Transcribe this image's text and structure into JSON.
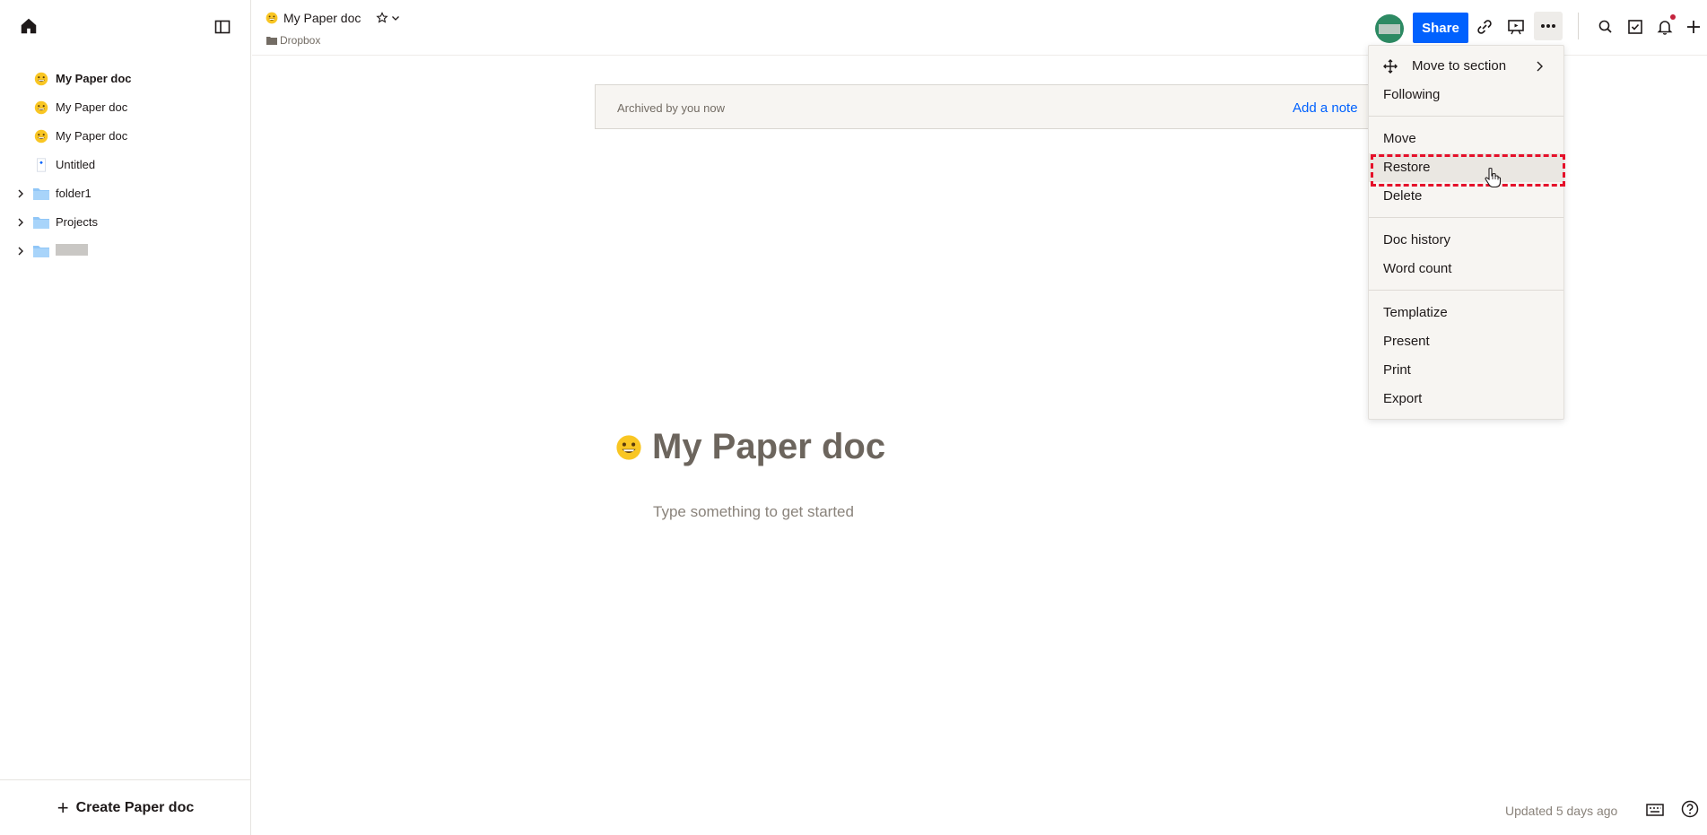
{
  "sidebar": {
    "items": [
      {
        "label": "My Paper doc",
        "icon": "emoji-grin-icon",
        "active": true
      },
      {
        "label": "My Paper doc",
        "icon": "emoji-grin-icon"
      },
      {
        "label": "My Paper doc",
        "icon": "emoji-grin-icon"
      },
      {
        "label": "Untitled",
        "icon": "doc-icon"
      },
      {
        "label": "folder1",
        "icon": "folder-icon",
        "expandable": true
      },
      {
        "label": "Projects",
        "icon": "folder-icon",
        "expandable": true
      },
      {
        "label": "",
        "icon": "folder-icon",
        "expandable": true,
        "redacted": true
      }
    ],
    "create_label": "Create Paper doc"
  },
  "header": {
    "doc_title": "My Paper doc",
    "breadcrumb": "Dropbox",
    "share_label": "Share"
  },
  "banner": {
    "text": "Archived by you now",
    "link": "Add a note"
  },
  "document": {
    "title": "My Paper doc",
    "placeholder": "Type something to get started"
  },
  "footer": {
    "updated": "Updated 5 days ago"
  },
  "menu": {
    "move_to_section": "Move to section",
    "following": "Following",
    "move": "Move",
    "restore": "Restore",
    "delete": "Delete",
    "doc_history": "Doc history",
    "word_count": "Word count",
    "templatize": "Templatize",
    "present": "Present",
    "print": "Print",
    "export": "Export"
  },
  "colors": {
    "accent": "#0061fe",
    "highlight_border": "#e5102a",
    "avatar": "#2d8a63"
  }
}
